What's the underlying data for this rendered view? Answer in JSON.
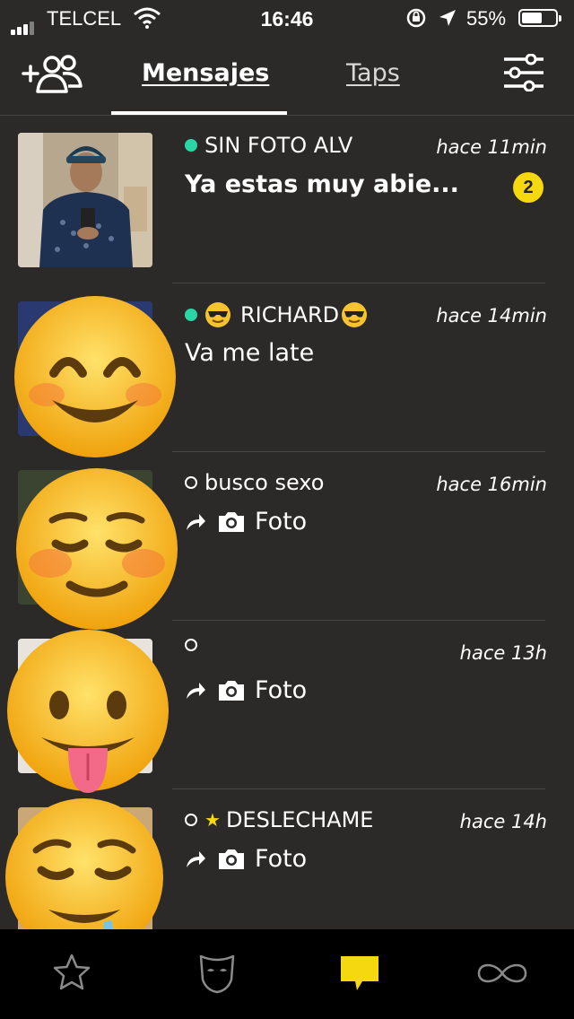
{
  "status_bar": {
    "carrier": "TELCEL",
    "time": "16:46",
    "battery_percent": "55%"
  },
  "header": {
    "tabs": [
      {
        "label": "Mensajes",
        "active": true
      },
      {
        "label": "Taps",
        "active": false
      }
    ]
  },
  "conversations": [
    {
      "name": "SIN FOTO ALV",
      "status": "online",
      "time": "hace 11min",
      "message": "Ya estas muy abie...",
      "unread": "2",
      "icon": "photo-thumbnail"
    },
    {
      "name": "RICHARD",
      "status": "online",
      "time": "hace 14min",
      "message": "Va me late",
      "icon": "smiling-face-emoji",
      "name_icons": [
        "sunglasses-emoji",
        "sunglasses-emoji"
      ]
    },
    {
      "name": "busco sexo",
      "status": "offline",
      "time": "hace 16min",
      "message": "Foto",
      "icon": "blushing-face-emoji"
    },
    {
      "name": "",
      "status": "offline",
      "time": "hace 13h",
      "message": "Foto",
      "icon": "tongue-face-emoji"
    },
    {
      "name": "DESLECHAME",
      "status": "offline",
      "favorite": true,
      "time": "hace 14h",
      "message": "Foto",
      "icon": "drooling-face-emoji"
    }
  ],
  "bottom_nav": [
    "star-icon",
    "mask-icon",
    "chat-icon",
    "infinity-icon"
  ],
  "colors": {
    "background": "#2b2a29",
    "online": "#2bd6a6",
    "accent": "#f5d80f",
    "nav_bg": "#000000"
  }
}
